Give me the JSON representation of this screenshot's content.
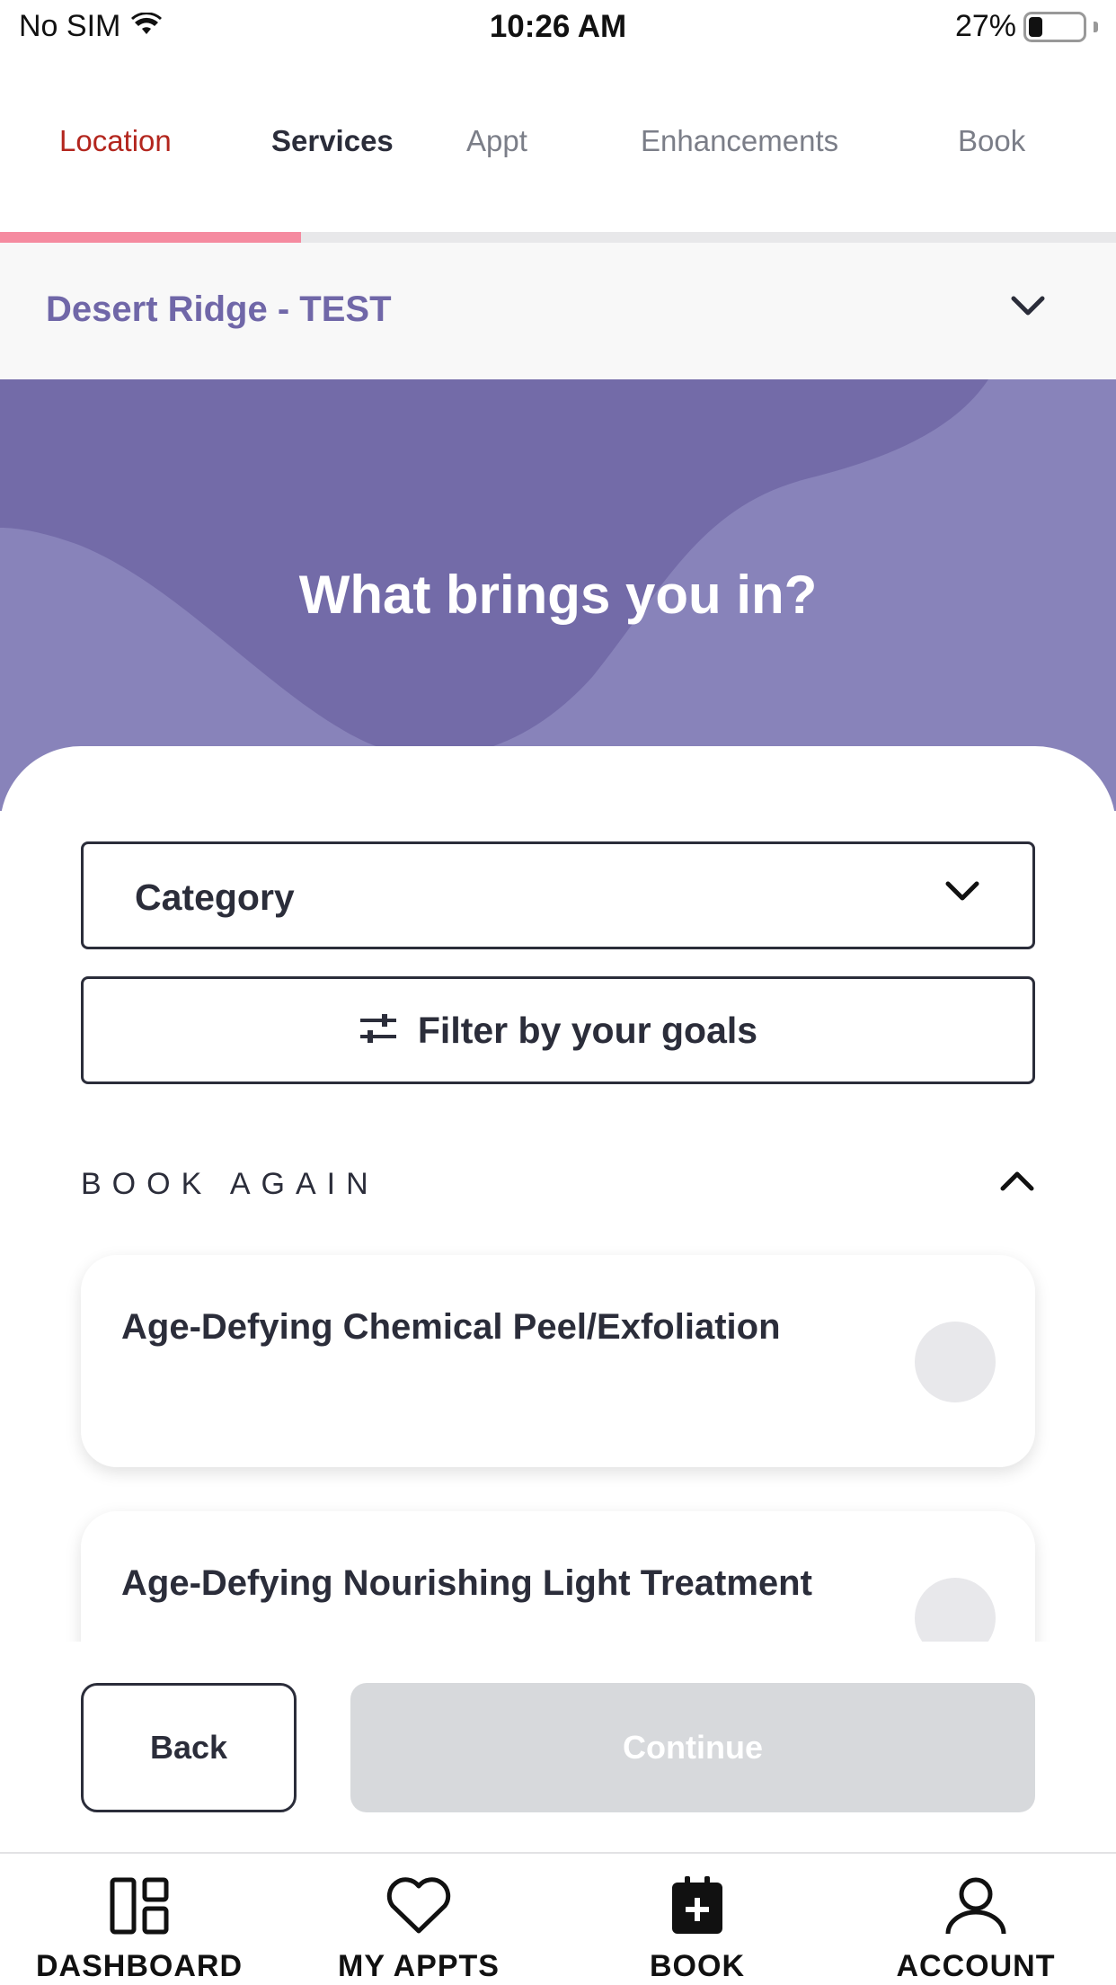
{
  "status_bar": {
    "carrier": "No SIM",
    "time": "10:26 AM",
    "battery": "27%"
  },
  "steps": {
    "items": [
      {
        "label": "Location",
        "state": "complete"
      },
      {
        "label": "Services",
        "state": "current"
      },
      {
        "label": "Appt",
        "state": "pending"
      },
      {
        "label": "Enhancements",
        "state": "pending"
      },
      {
        "label": "Book",
        "state": "pending"
      }
    ],
    "progress": 0.27
  },
  "location": {
    "name": "Desert Ridge - TEST"
  },
  "hero": {
    "title": "What brings you in?"
  },
  "filters": {
    "category_label": "Category",
    "goals_label": "Filter by your goals"
  },
  "book_again": {
    "heading": "BOOK AGAIN",
    "services": [
      {
        "name": "Age-Defying Chemical Peel/Exfoliation",
        "selected": false
      },
      {
        "name": "Age-Defying Nourishing Light Treatment",
        "selected": false
      }
    ]
  },
  "actions": {
    "back_label": "Back",
    "continue_label": "Continue"
  },
  "tab_bar": {
    "items": [
      {
        "label": "DASHBOARD",
        "icon": "dashboard-icon"
      },
      {
        "label": "MY APPTS",
        "icon": "heart-icon"
      },
      {
        "label": "BOOK",
        "icon": "calendar-plus-icon"
      },
      {
        "label": "ACCOUNT",
        "icon": "person-icon"
      }
    ]
  },
  "colors": {
    "accent_purple": "#7067a8",
    "hero_bg": "#8883ba",
    "active_step_red": "#b3261e",
    "progress_pink": "#f58ba0",
    "disabled_gray": "#d7d9dc"
  }
}
